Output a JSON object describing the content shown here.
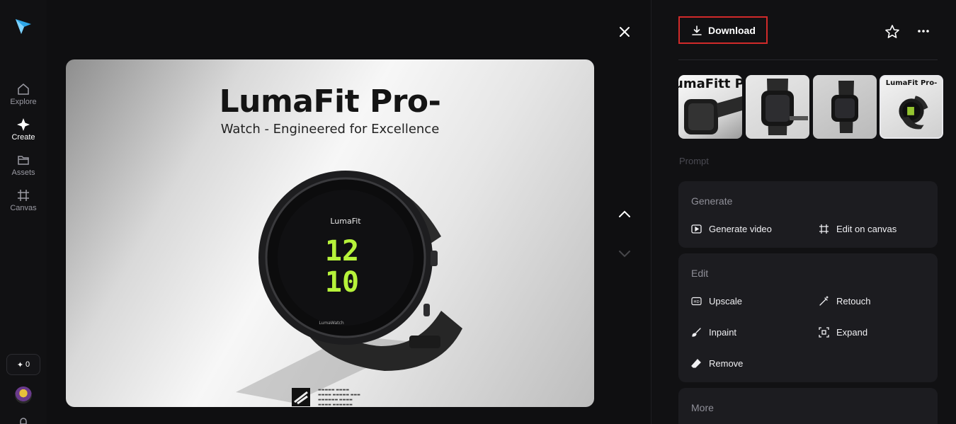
{
  "rail": {
    "items": [
      {
        "label": "Explore",
        "icon": "home-icon"
      },
      {
        "label": "Create",
        "icon": "sparkle-icon"
      },
      {
        "label": "Assets",
        "icon": "folder-icon"
      },
      {
        "label": "Canvas",
        "icon": "canvas-icon"
      }
    ],
    "credits": "0"
  },
  "viewer": {
    "image_title": "LumaFit Pro-",
    "image_subtitle": "Watch - Engineered for Excellence",
    "watch_brand": "LumaFit",
    "watch_time_top": "12",
    "watch_time_bottom": "10",
    "watch_bottom_text": "LumaWatch"
  },
  "panel": {
    "download_label": "Download",
    "thumbnails": [
      {
        "text": "umaFitt P"
      },
      {
        "text": ""
      },
      {
        "text": ""
      },
      {
        "text": "LumaFit Pro-"
      }
    ],
    "prompt_label": "Prompt",
    "generate": {
      "title": "Generate",
      "actions": [
        {
          "label": "Generate video",
          "icon": "play-square-icon"
        },
        {
          "label": "Edit on canvas",
          "icon": "crop-icon"
        }
      ]
    },
    "edit": {
      "title": "Edit",
      "actions": [
        {
          "label": "Upscale",
          "icon": "hd-icon"
        },
        {
          "label": "Retouch",
          "icon": "magic-wand-icon"
        },
        {
          "label": "Inpaint",
          "icon": "brush-icon"
        },
        {
          "label": "Expand",
          "icon": "expand-icon"
        },
        {
          "label": "Remove",
          "icon": "eraser-icon"
        }
      ]
    },
    "more": {
      "title": "More"
    }
  },
  "colors": {
    "background": "#0f0f11",
    "card": "#1c1c20",
    "highlight_border": "#d12a2a",
    "watch_digits": "#b6f23a"
  }
}
